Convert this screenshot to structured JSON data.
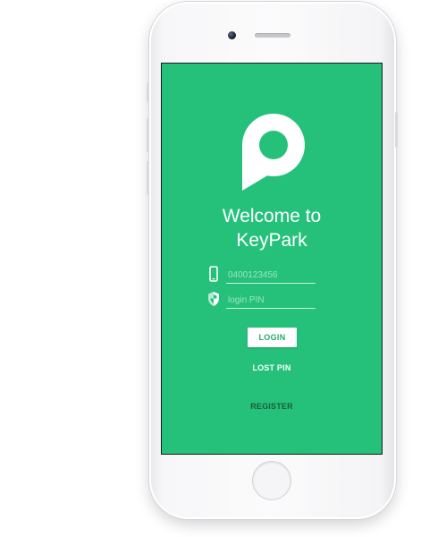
{
  "app": {
    "name": "KeyPark",
    "brand_color": "#25c17b",
    "logo_icon": "keypark-p-logo-icon"
  },
  "welcome": {
    "line1": "Welcome to",
    "line2": "KeyPark"
  },
  "form": {
    "phone": {
      "icon": "smartphone-icon",
      "placeholder": "0400123456",
      "value": ""
    },
    "pin": {
      "icon": "shield-icon",
      "placeholder": "login PIN",
      "value": ""
    },
    "login_label": "LOGIN",
    "lost_pin_label": "LOST PIN",
    "register_label": "REGISTER"
  }
}
